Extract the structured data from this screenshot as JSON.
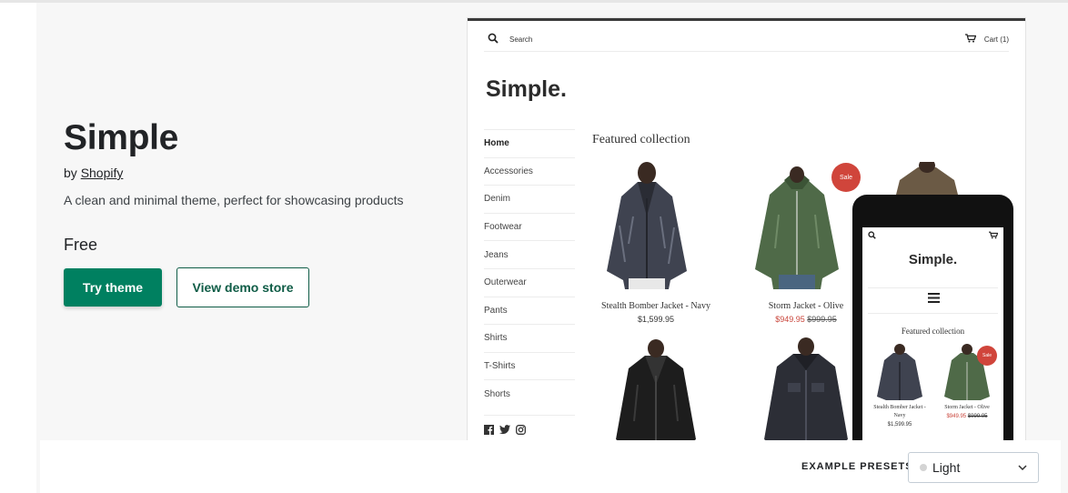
{
  "theme": {
    "title": "Simple",
    "by_prefix": "by",
    "author": "Shopify",
    "description": "A clean and minimal theme, perfect for showcasing products",
    "price": "Free",
    "try_label": "Try theme",
    "demo_label": "View demo store"
  },
  "desktop_preview": {
    "search_label": "Search",
    "cart_label": "Cart (1)",
    "logo": "Simple.",
    "nav": [
      "Home",
      "Accessories",
      "Denim",
      "Footwear",
      "Jeans",
      "Outerwear",
      "Pants",
      "Shirts",
      "T-Shirts",
      "Shorts"
    ],
    "featured_title": "Featured collection",
    "sale_badge": "Sale",
    "products": [
      {
        "name": "Stealth Bomber Jacket - Navy",
        "price": "$1,599.95"
      },
      {
        "name": "Storm Jacket - Olive",
        "sale_price": "$949.95",
        "old_price": "$999.95"
      }
    ]
  },
  "mobile_preview": {
    "logo": "Simple.",
    "featured_title": "Featured collection",
    "sale_badge": "Sale",
    "products": [
      {
        "name": "Stealth Bomber Jacket - Navy",
        "price": "$1,599.95"
      },
      {
        "name": "Storm Jacket - Olive",
        "sale_price": "$949.95",
        "old_price": "$999.95"
      }
    ]
  },
  "presets": {
    "label": "EXAMPLE PRESETS",
    "selected": "Light"
  },
  "colors": {
    "primary_green": "#008060",
    "secondary_border": "#0f5c46",
    "sale_red": "#d0453b"
  }
}
